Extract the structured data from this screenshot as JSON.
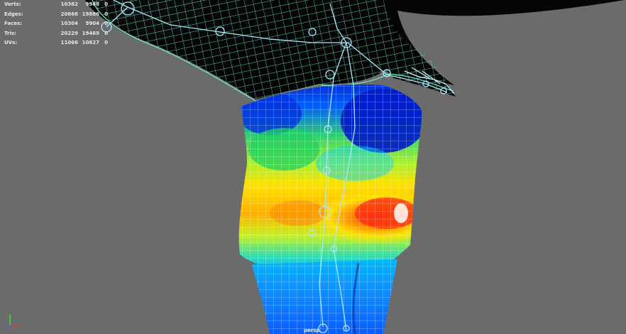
{
  "hud": {
    "rows": [
      {
        "label": "Verts:",
        "values": [
          "10362",
          "9988",
          "0"
        ]
      },
      {
        "label": "Edges:",
        "values": [
          "20666",
          "19886",
          "0"
        ]
      },
      {
        "label": "Faces:",
        "values": [
          "10304",
          "9904",
          "0"
        ]
      },
      {
        "label": "Tris:",
        "values": [
          "20229",
          "19469",
          "0"
        ]
      },
      {
        "label": "UVs:",
        "values": [
          "11066",
          "10627",
          "0"
        ]
      }
    ]
  },
  "viewport": {
    "camera": "persp",
    "background_color": "#6b6b6b",
    "wireframe_color": "#6ef0c8",
    "skeleton_color": "#a8e8f8"
  },
  "heatmap": {
    "colors": [
      "#0018c8",
      "#0070ff",
      "#00d0ff",
      "#30e080",
      "#c8f020",
      "#ffe000",
      "#ff8000",
      "#ff3010"
    ]
  },
  "axis_gizmo": {
    "y_color": "#40e040",
    "x_color": "#e04040"
  }
}
